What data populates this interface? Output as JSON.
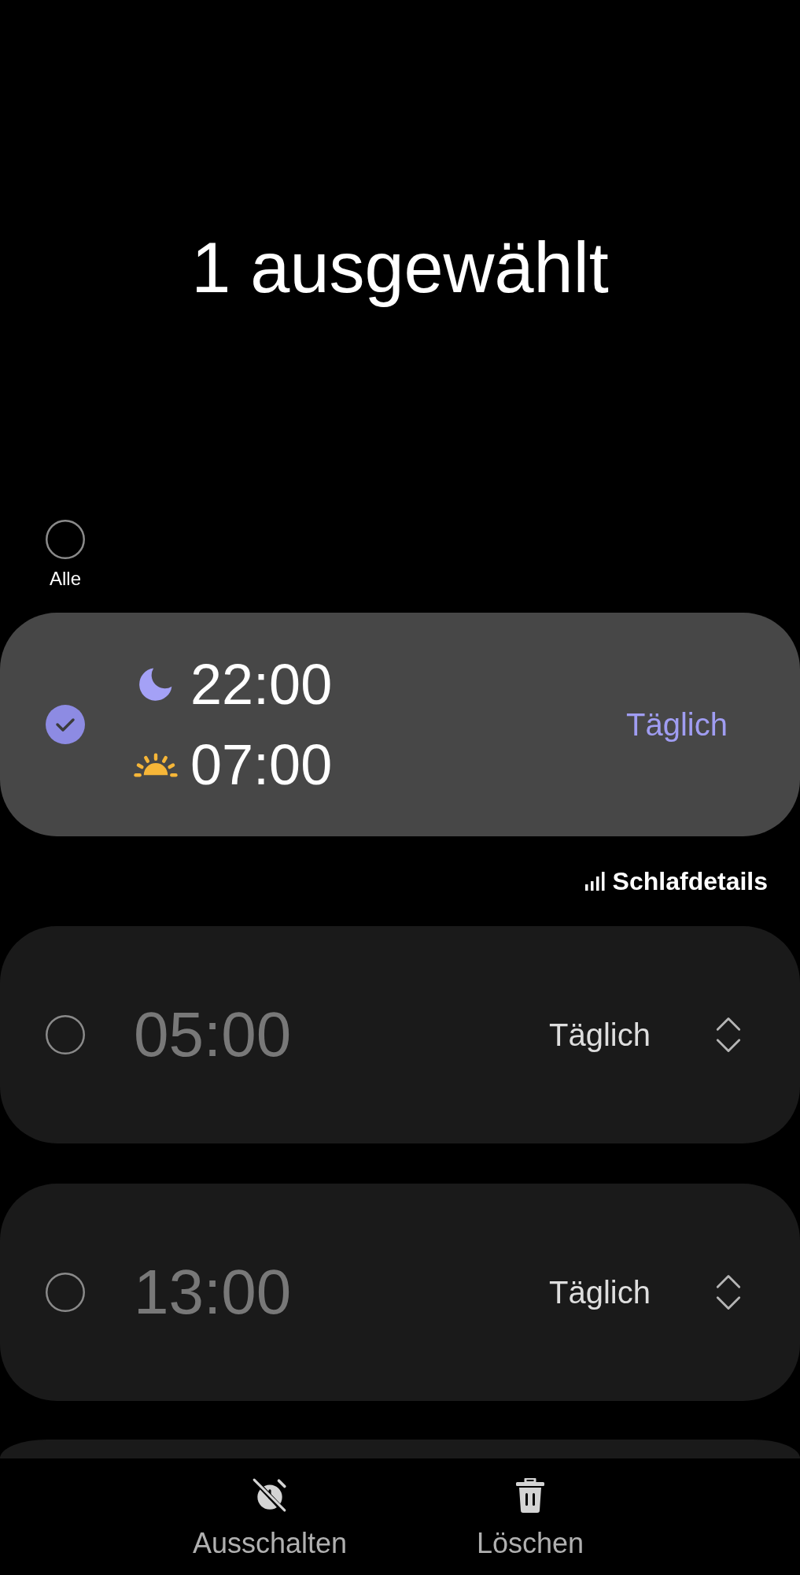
{
  "header": {
    "title": "1 ausgewählt"
  },
  "select_all": {
    "label": "Alle",
    "checked": false
  },
  "alarms": [
    {
      "kind": "sleep",
      "selected": true,
      "on": true,
      "bedtime": "22:00",
      "wake_time": "07:00",
      "repeat": "Täglich",
      "details_link": "Schlafdetails"
    },
    {
      "kind": "alarm",
      "selected": false,
      "on": false,
      "time": "05:00",
      "repeat": "Täglich"
    },
    {
      "kind": "alarm",
      "selected": false,
      "on": false,
      "time": "13:00",
      "repeat": "Täglich"
    }
  ],
  "bottom_actions": [
    {
      "kind": "turn_off",
      "label": "Ausschalten"
    },
    {
      "kind": "delete",
      "label": "Löschen"
    }
  ]
}
